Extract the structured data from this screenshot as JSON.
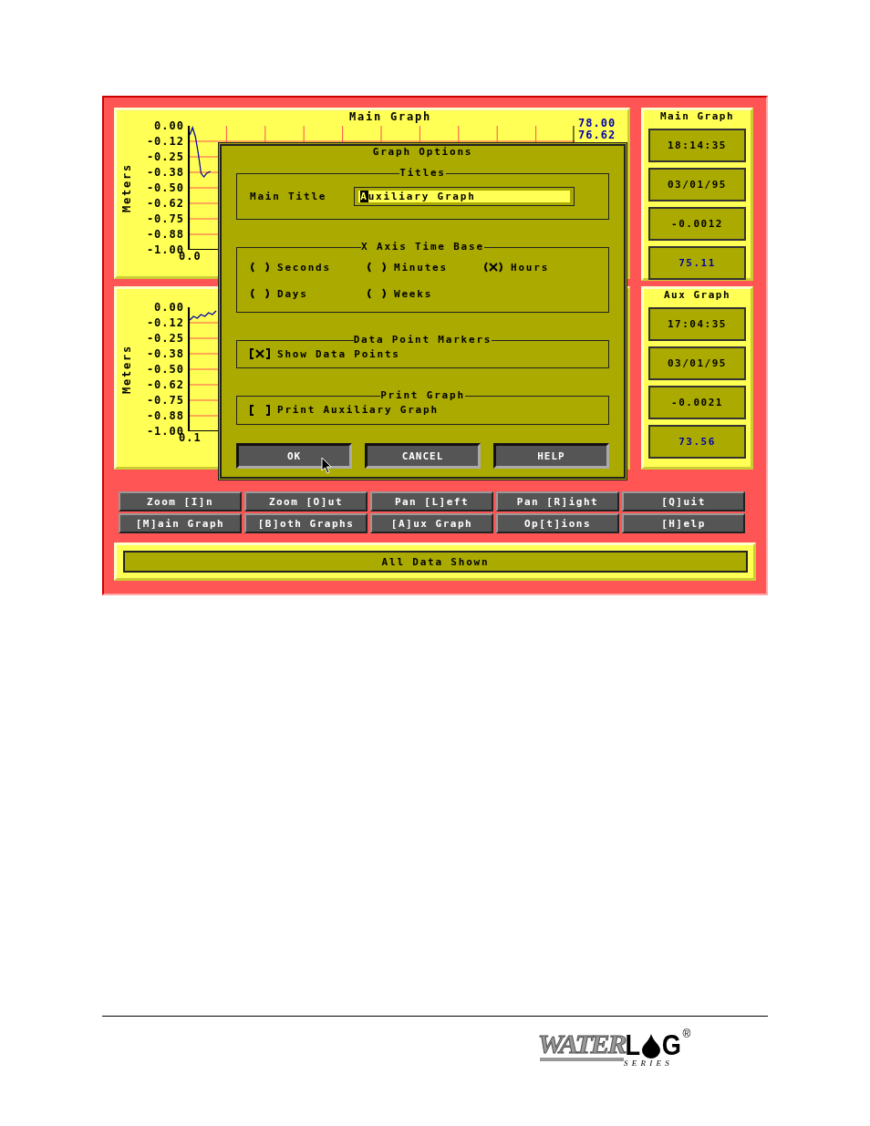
{
  "screen": {
    "graphs": [
      {
        "title": "Main Graph",
        "y_label": "Meters",
        "y_ticks": [
          "0.00",
          "-0.12",
          "-0.25",
          "-0.38",
          "-0.50",
          "-0.62",
          "-0.75",
          "-0.88",
          "-1.00"
        ],
        "x_tick": "0.0",
        "right_ticks": [
          "78.00",
          "76.62"
        ]
      },
      {
        "y_label": "Meters",
        "y_ticks": [
          "0.00",
          "-0.12",
          "-0.25",
          "-0.38",
          "-0.50",
          "-0.62",
          "-0.75",
          "-0.88",
          "-1.00"
        ],
        "x_tick": "0.1"
      }
    ],
    "readouts": [
      {
        "title": "Main Graph",
        "values": [
          {
            "text": "18:14:35",
            "color": "#000000"
          },
          {
            "text": "03/01/95",
            "color": "#000000"
          },
          {
            "text": "-0.0012",
            "color": "#000000"
          },
          {
            "text": "75.11",
            "color": "#0000aa"
          }
        ]
      },
      {
        "title": "Aux Graph",
        "values": [
          {
            "text": "17:04:35",
            "color": "#000000"
          },
          {
            "text": "03/01/95",
            "color": "#000000"
          },
          {
            "text": "-0.0021",
            "color": "#000000"
          },
          {
            "text": "73.56",
            "color": "#0000aa"
          }
        ]
      }
    ],
    "dialog": {
      "title": "Graph Options",
      "groups": [
        {
          "kind": "field",
          "legend": "Titles",
          "label": "Main Title",
          "value": "Auxiliary Graph"
        },
        {
          "kind": "radios",
          "legend": "X Axis Time Base",
          "options": [
            {
              "label": "Seconds",
              "selected": false
            },
            {
              "label": "Minutes",
              "selected": false
            },
            {
              "label": "Hours",
              "selected": true
            },
            {
              "label": "Days",
              "selected": false
            },
            {
              "label": "Weeks",
              "selected": false
            }
          ]
        },
        {
          "kind": "checkbox",
          "legend": "Data Point Markers",
          "label": "Show Data Points",
          "checked": true
        },
        {
          "kind": "checkbox",
          "legend": "Print Graph",
          "label": "Print Auxiliary Graph",
          "checked": false
        }
      ],
      "buttons": [
        "OK",
        "CANCEL",
        "HELP"
      ]
    },
    "toolbar": [
      "Zoom [I]n",
      "Zoom [O]ut",
      "Pan [L]eft",
      "Pan [R]ight",
      "[Q]uit",
      "[M]ain Graph",
      "[B]oth Graphs",
      "[A]ux Graph",
      "Op[t]ions",
      "[H]elp"
    ],
    "status": "All Data Shown"
  },
  "logo": {
    "word": "WATER",
    "before_drop": "L",
    "after_drop": "G",
    "mark": "®",
    "series": "S E R I E S"
  }
}
